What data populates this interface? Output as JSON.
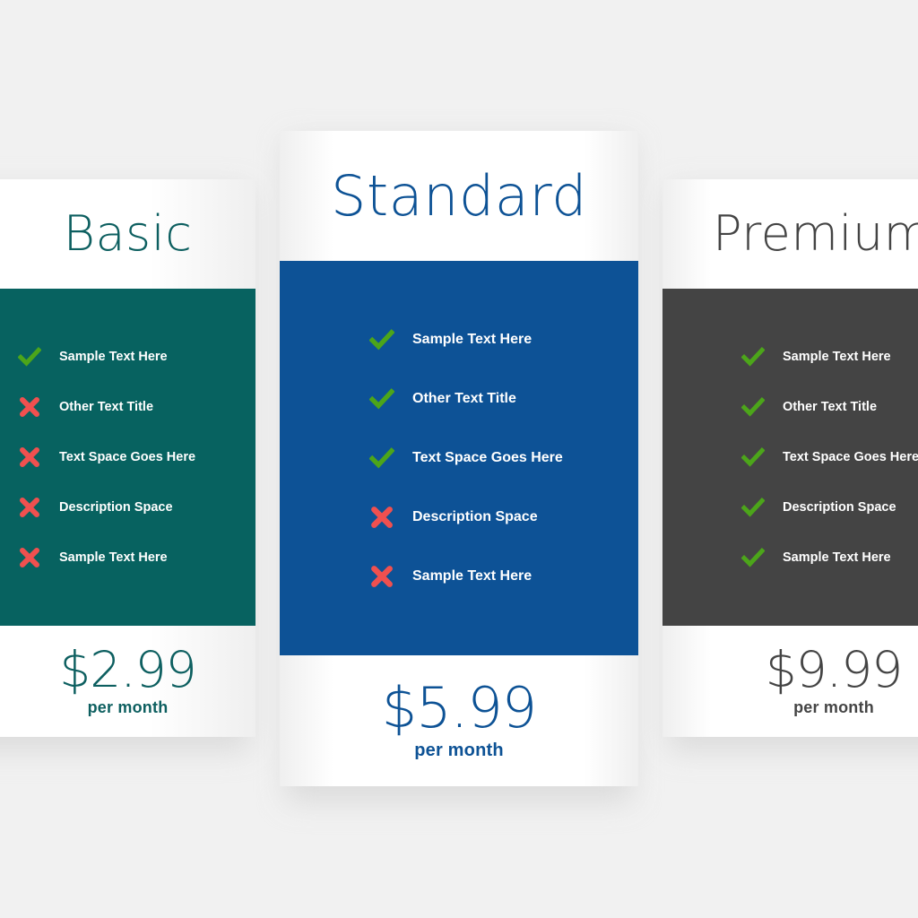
{
  "page": {
    "background_color": "#f1f1f1",
    "period_label": "per month",
    "icon_colors": {
      "check": "#4ca51a",
      "cross": "#f0504f"
    }
  },
  "plans": [
    {
      "id": "basic",
      "title": "Basic",
      "accent_color": "#076260",
      "title_color": "#0d5f60",
      "price": "$2.99",
      "period": "per month",
      "features": [
        {
          "label": "Sample Text Here",
          "icon": "check-icon",
          "included": true
        },
        {
          "label": "Other Text Title",
          "icon": "cross-icon",
          "included": false
        },
        {
          "label": "Text Space Goes Here",
          "icon": "cross-icon",
          "included": false
        },
        {
          "label": "Description Space",
          "icon": "cross-icon",
          "included": false
        },
        {
          "label": "Sample Text Here",
          "icon": "cross-icon",
          "included": false
        }
      ]
    },
    {
      "id": "standard",
      "title": "Standard",
      "accent_color": "#0d5296",
      "title_color": "#0d5295",
      "price": "$5.99",
      "period": "per month",
      "features": [
        {
          "label": "Sample Text Here",
          "icon": "check-icon",
          "included": true
        },
        {
          "label": "Other Text Title",
          "icon": "check-icon",
          "included": true
        },
        {
          "label": "Text Space Goes Here",
          "icon": "check-icon",
          "included": true
        },
        {
          "label": "Description Space",
          "icon": "cross-icon",
          "included": false
        },
        {
          "label": "Sample Text Here",
          "icon": "cross-icon",
          "included": false
        }
      ]
    },
    {
      "id": "premium",
      "title": "Premium",
      "accent_color": "#444444",
      "title_color": "#444444",
      "price": "$9.99",
      "period": "per month",
      "features": [
        {
          "label": "Sample Text Here",
          "icon": "check-icon",
          "included": true
        },
        {
          "label": "Other Text Title",
          "icon": "check-icon",
          "included": true
        },
        {
          "label": "Text Space Goes Here",
          "icon": "check-icon",
          "included": true
        },
        {
          "label": "Description Space",
          "icon": "check-icon",
          "included": true
        },
        {
          "label": "Sample Text Here",
          "icon": "check-icon",
          "included": true
        }
      ]
    }
  ]
}
